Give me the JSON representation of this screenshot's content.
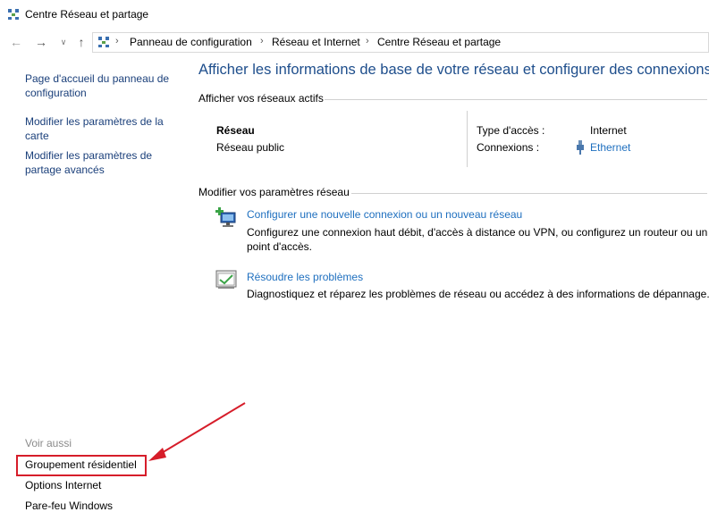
{
  "window": {
    "title": "Centre Réseau et partage",
    "icon": "network-center-icon"
  },
  "nav": {
    "back_icon": "arrow-left-icon",
    "forward_icon": "arrow-right-icon",
    "recent_icon": "chevron-down-icon",
    "up_icon": "arrow-up-icon"
  },
  "breadcrumb": [
    "Panneau de configuration",
    "Réseau et Internet",
    "Centre Réseau et partage"
  ],
  "sidebar": {
    "links": [
      "Page d'accueil du panneau de configuration",
      "Modifier les paramètres de la carte",
      "Modifier les paramètres de partage avancés"
    ],
    "see_also_label": "Voir aussi",
    "see_also": [
      "Groupement résidentiel",
      "Options Internet",
      "Pare-feu Windows"
    ]
  },
  "main": {
    "heading": "Afficher les informations de base de votre réseau et configurer des connexions",
    "active_label": "Afficher vos réseaux actifs",
    "network_name": "Réseau",
    "network_type": "Réseau public",
    "access_type_label": "Type d'accès :",
    "access_type_value": "Internet",
    "connections_label": "Connexions :",
    "connection_value": "Ethernet",
    "modify_label": "Modifier vos paramètres réseau",
    "tasks": [
      {
        "icon": "new-connection-icon",
        "title": "Configurer une nouvelle connexion ou un nouveau réseau",
        "desc_line1": "Configurez une connexion haut débit, d'accès à distance ou VPN, ou configurez un routeur ou un",
        "desc_line2": "point d'accès."
      },
      {
        "icon": "troubleshoot-icon",
        "title": "Résoudre les problèmes",
        "desc_line1": "Diagnostiquez et réparez les problèmes de réseau ou accédez à des informations de dépannage."
      }
    ]
  },
  "annotation": {
    "color": "#d61d2a"
  }
}
